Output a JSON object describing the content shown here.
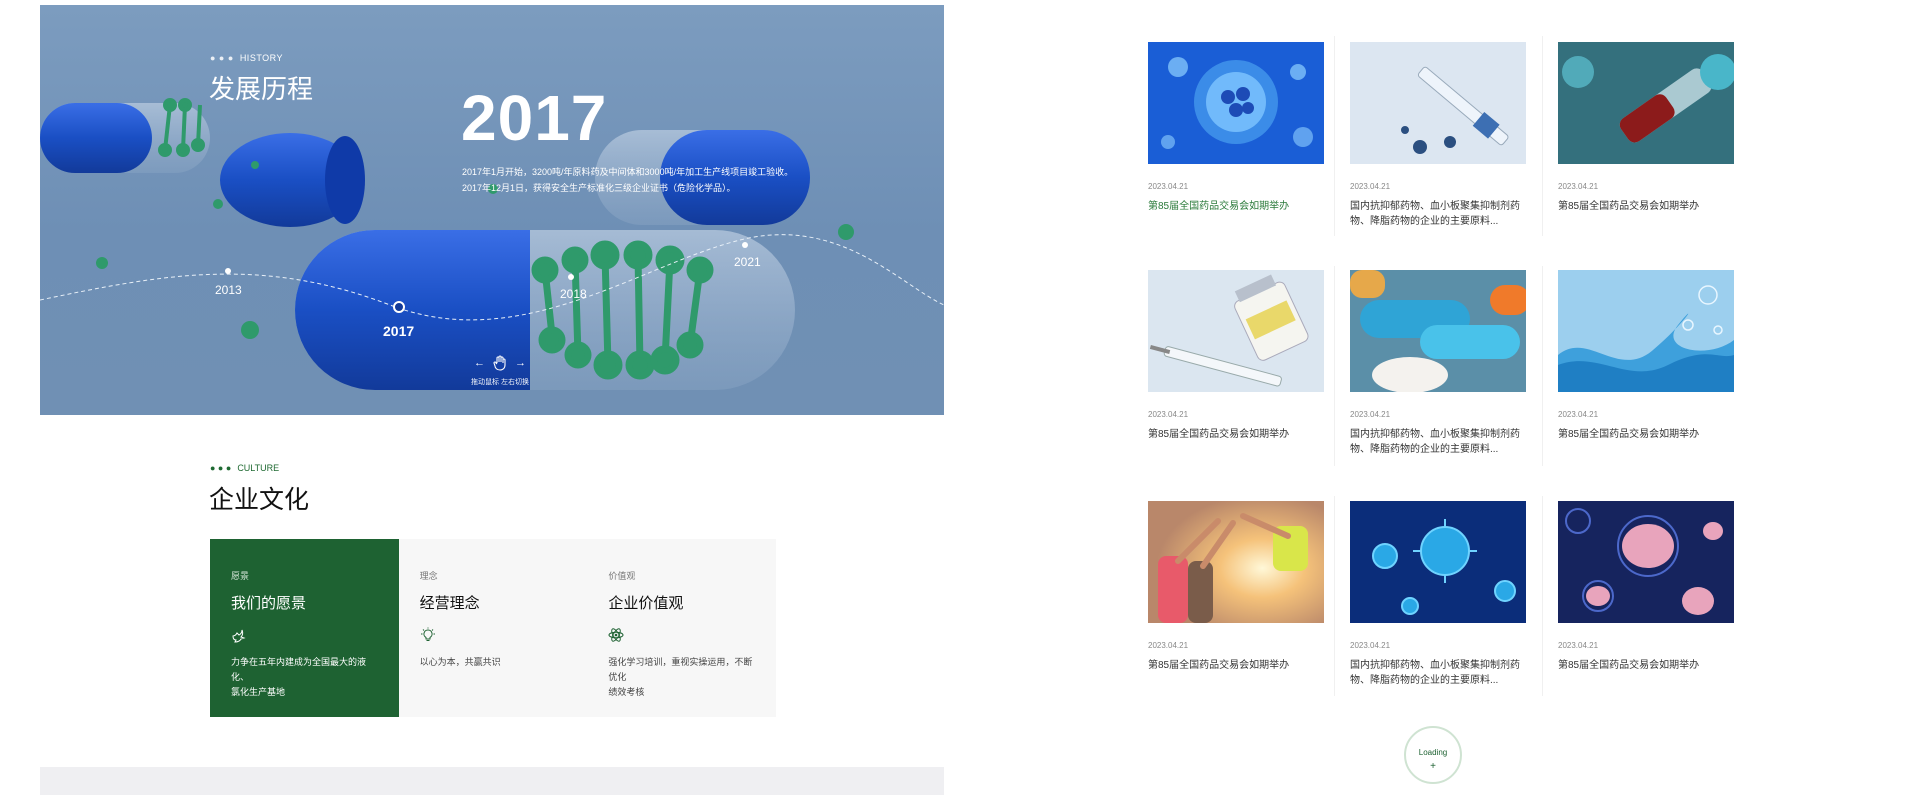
{
  "history": {
    "eyebrow": "HISTORY",
    "title": "发展历程",
    "year": "2017",
    "desc_lines": [
      "2017年1月开始，3200吨/年原料药及中间体和3000吨/年加工生产线项目竣工验收。",
      "2017年12月1日，获得安全生产标准化三级企业证书（危险化学品）。"
    ],
    "timeline": [
      "2013",
      "2017",
      "2018",
      "2021"
    ],
    "nav_caption": "拖动鼠标 左右切换"
  },
  "culture": {
    "eyebrow": "CULTURE",
    "title": "企业文化",
    "cards": [
      {
        "small": "愿景",
        "heading": "我们的愿景",
        "icon": "dove-icon",
        "text_lines": [
          "力争在五年内建成为全国最大的液化、",
          "氯化生产基地"
        ]
      },
      {
        "small": "理念",
        "heading": "经营理念",
        "icon": "lightbulb-icon",
        "text_lines": [
          "以心为本，共赢共识"
        ]
      },
      {
        "small": "价值观",
        "heading": "企业价值观",
        "icon": "atom-icon",
        "text_lines": [
          "强化学习培训，重视实操运用，不断优化",
          "绩效考核"
        ]
      }
    ]
  },
  "news": [
    {
      "date": "2023.04.21",
      "title_lines": [
        "第85届全国药品交易会如期举办"
      ],
      "image": "cell-embryo-image",
      "highlight": true
    },
    {
      "date": "2023.04.21",
      "title_lines": [
        "国内抗抑郁药物、血小板聚集抑制剂药",
        "物、降脂药物的企业的主要原料..."
      ],
      "image": "syringe-virus-image"
    },
    {
      "date": "2023.04.21",
      "title_lines": [
        "第85届全国药品交易会如期举办"
      ],
      "image": "lab-tube-image"
    },
    {
      "date": "2023.04.21",
      "title_lines": [
        "第85届全国药品交易会如期举办"
      ],
      "image": "vial-syringe-image"
    },
    {
      "date": "2023.04.21",
      "title_lines": [
        "国内抗抑郁药物、血小板聚集抑制剂药",
        "物、降脂药物的企业的主要原料..."
      ],
      "image": "pills-image"
    },
    {
      "date": "2023.04.21",
      "title_lines": [
        "第85届全国药品交易会如期举办"
      ],
      "image": "water-splash-image"
    },
    {
      "date": "2023.04.21",
      "title_lines": [
        "第85届全国药品交易会如期举办"
      ],
      "image": "team-hands-image"
    },
    {
      "date": "2023.04.21",
      "title_lines": [
        "国内抗抑郁药物、血小板聚集抑制剂药",
        "物、降脂药物的企业的主要原料..."
      ],
      "image": "virus-blue-image"
    },
    {
      "date": "2023.04.21",
      "title_lines": [
        "第85届全国药品交易会如期举办"
      ],
      "image": "cells-pink-image"
    }
  ],
  "loading": {
    "label": "Loading",
    "plus": "+"
  },
  "colors": {
    "brand_green": "#1e6232",
    "hero_blue": "#7c9cbf",
    "pill_blue": "#1a4fc4"
  }
}
